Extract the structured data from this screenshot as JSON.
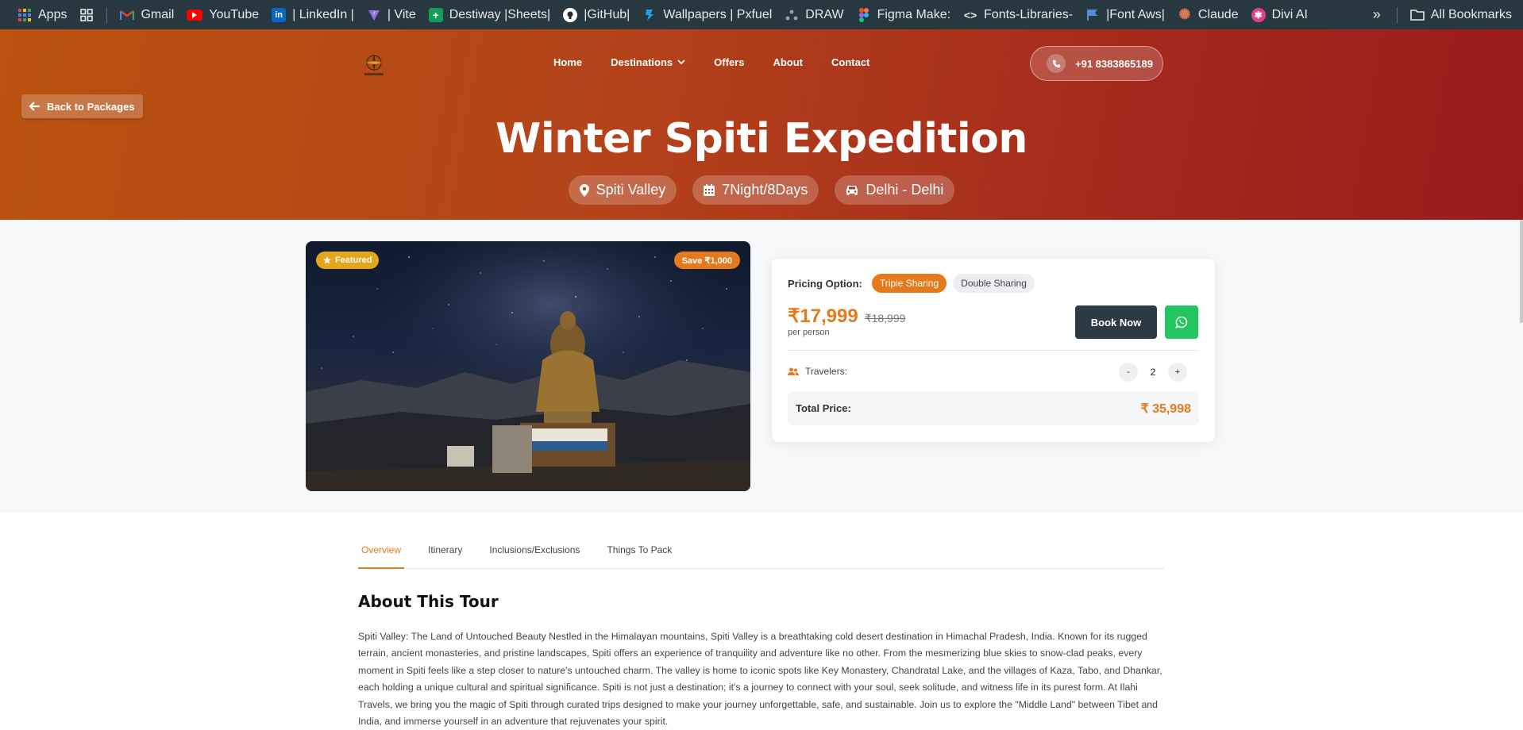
{
  "bookmarks": {
    "items": [
      {
        "label": "Apps",
        "icon": "apps-grid-icon"
      },
      {
        "label": "",
        "icon": "tab-groups-icon"
      },
      {
        "label": "Gmail",
        "icon": "gmail-icon"
      },
      {
        "label": "YouTube",
        "icon": "youtube-icon"
      },
      {
        "label": "| LinkedIn |",
        "icon": "linkedin-icon"
      },
      {
        "label": "| Vite",
        "icon": "vite-icon"
      },
      {
        "label": "Destiway |Sheets|",
        "icon": "sheets-icon"
      },
      {
        "label": "|GitHub|",
        "icon": "github-icon"
      },
      {
        "label": "Wallpapers | Pxfuel",
        "icon": "pxfuel-icon"
      },
      {
        "label": "DRAW",
        "icon": "draw-icon"
      },
      {
        "label": "Figma Make:",
        "icon": "figma-icon"
      },
      {
        "label": "Fonts-Libraries-",
        "icon": "code-icon"
      },
      {
        "label": "|Font Aws|",
        "icon": "flag-icon"
      },
      {
        "label": "Claude",
        "icon": "claude-icon"
      },
      {
        "label": "Divi AI",
        "icon": "divi-icon"
      }
    ],
    "overflow": "»",
    "all_bookmarks": "All Bookmarks"
  },
  "header": {
    "nav": [
      "Home",
      "Destinations",
      "Offers",
      "About",
      "Contact"
    ],
    "phone": "+91 8383865189",
    "back": "Back to Packages"
  },
  "hero": {
    "title": "Winter Spiti Expedition",
    "chips": [
      {
        "icon": "map-pin-icon",
        "label": "Spiti Valley"
      },
      {
        "icon": "calendar-icon",
        "label": "7Night/8Days"
      },
      {
        "icon": "car-icon",
        "label": "Delhi - Delhi"
      }
    ]
  },
  "photo": {
    "featured": "Featured",
    "save": "Save ₹1,000"
  },
  "booking": {
    "pricing_label": "Pricing Option:",
    "options": [
      "Triple Sharing",
      "Double Sharing"
    ],
    "selected_option": "Triple Sharing",
    "price": "₹17,999",
    "old_price": "₹18,999",
    "per_person": "per person",
    "book_now": "Book Now",
    "travelers_label": "Travelers:",
    "minus": "-",
    "travelers": "2",
    "plus": "+",
    "total_label": "Total Price:",
    "total_value": "₹ 35,998"
  },
  "tabs": [
    "Overview",
    "Itinerary",
    "Inclusions/Exclusions",
    "Things To Pack"
  ],
  "active_tab": "Overview",
  "about": {
    "title": "About This Tour",
    "text": "Spiti Valley: The Land of Untouched Beauty Nestled in the Himalayan mountains, Spiti Valley is a breathtaking cold desert destination in Himachal Pradesh, India. Known for its rugged terrain, ancient monasteries, and pristine landscapes, Spiti offers an experience of tranquility and adventure like no other. From the mesmerizing blue skies to snow-clad peaks, every moment in Spiti feels like a step closer to nature's untouched charm. The valley is home to iconic spots like Key Monastery, Chandratal Lake, and the villages of Kaza, Tabo, and Dhankar, each holding a unique cultural and spiritual significance. Spiti is not just a destination; it's a journey to connect with your soul, seek solitude, and witness life in its purest form. At Ilahi Travels, we bring you the magic of Spiti through curated trips designed to make your journey unforgettable, safe, and sustainable. Join us to explore the \"Middle Land\" between Tibet and India, and immerse yourself in an adventure that rejuvenates your spirit."
  },
  "colors": {
    "accent": "#e57a1d",
    "hero_start": "#b9530f",
    "hero_end": "#9a1b1c",
    "dark_button": "#2c3a45",
    "whatsapp": "#22c55e",
    "featured": "#e5a619"
  }
}
